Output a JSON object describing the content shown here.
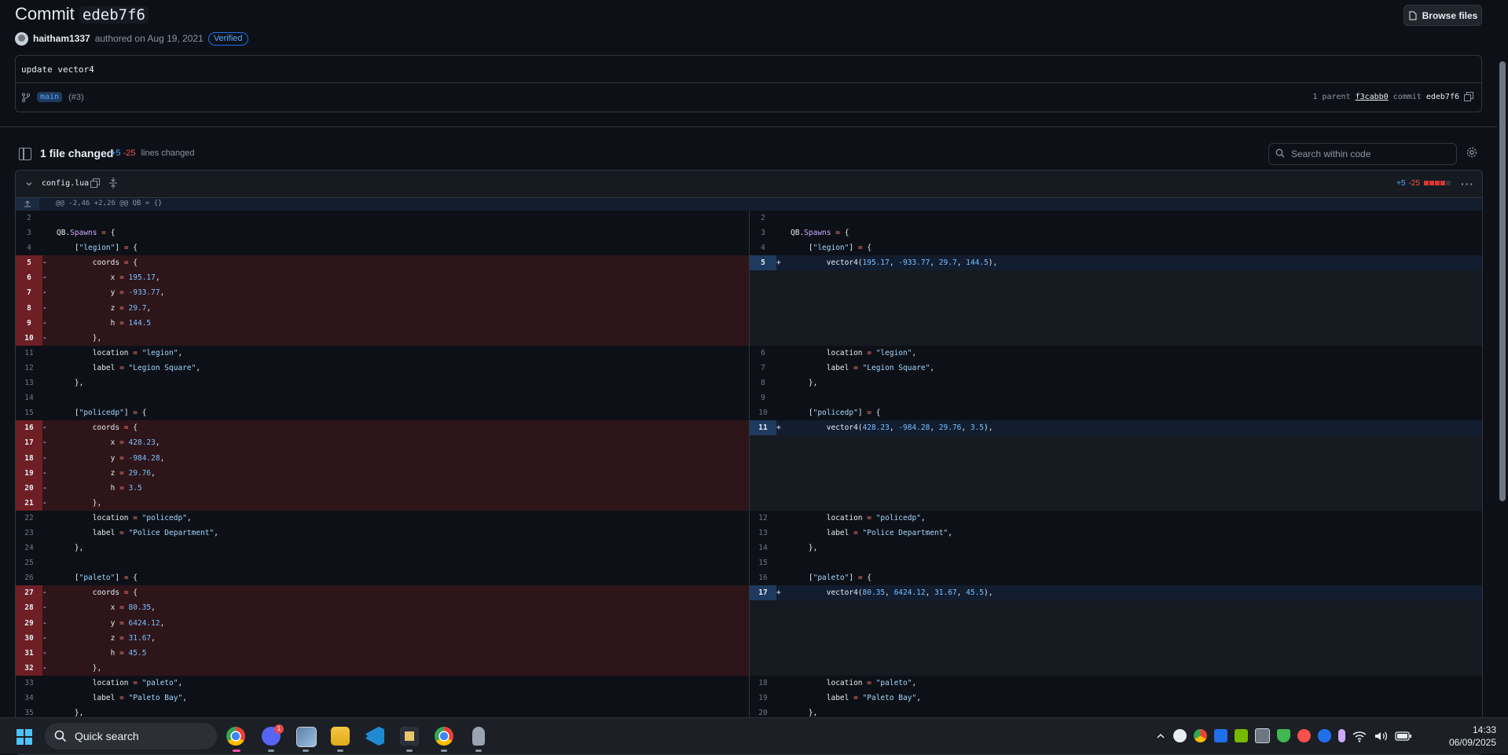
{
  "commit": {
    "title_prefix": "Commit",
    "sha_short": "edeb7f6",
    "browse_label": "Browse files",
    "author": "haitham1337",
    "authored_text": "authored on Aug 19, 2021",
    "verified_label": "Verified",
    "message": "update vector4",
    "branch": "main",
    "pr_ref": "(#3)",
    "parent_label": "1 parent",
    "parent_sha": "f3cabb0",
    "commit_label": "commit",
    "commit_sha": "edeb7f6"
  },
  "files_bar": {
    "files_changed": "1 file changed",
    "additions": "+5",
    "deletions": "-25",
    "lines_changed_label": "lines changed",
    "search_placeholder": "Search within code"
  },
  "file": {
    "name": "config.lua",
    "additions": "+5",
    "deletions": "-25",
    "hunk_header": "@@ -2,46 +2,26 @@ QB = {}"
  },
  "diff": {
    "left": [
      {
        "ln": "2",
        "sign": "",
        "type": "ctx",
        "code": ""
      },
      {
        "ln": "3",
        "sign": "",
        "type": "ctx",
        "code": "QB.Spawns = {"
      },
      {
        "ln": "4",
        "sign": "",
        "type": "ctx",
        "code": "    [\"legion\"] = {"
      },
      {
        "ln": "5",
        "sign": "-",
        "type": "del",
        "code": "        coords = {"
      },
      {
        "ln": "6",
        "sign": "-",
        "type": "del",
        "code": "            x = 195.17,"
      },
      {
        "ln": "7",
        "sign": "-",
        "type": "del",
        "code": "            y = -933.77,"
      },
      {
        "ln": "8",
        "sign": "-",
        "type": "del",
        "code": "            z = 29.7,"
      },
      {
        "ln": "9",
        "sign": "-",
        "type": "del",
        "code": "            h = 144.5"
      },
      {
        "ln": "10",
        "sign": "-",
        "type": "del",
        "code": "        },"
      },
      {
        "ln": "11",
        "sign": "",
        "type": "ctx",
        "code": "        location = \"legion\","
      },
      {
        "ln": "12",
        "sign": "",
        "type": "ctx",
        "code": "        label = \"Legion Square\","
      },
      {
        "ln": "13",
        "sign": "",
        "type": "ctx",
        "code": "    },"
      },
      {
        "ln": "14",
        "sign": "",
        "type": "ctx",
        "code": ""
      },
      {
        "ln": "15",
        "sign": "",
        "type": "ctx",
        "code": "    [\"policedp\"] = {"
      },
      {
        "ln": "16",
        "sign": "-",
        "type": "del",
        "code": "        coords = {"
      },
      {
        "ln": "17",
        "sign": "-",
        "type": "del",
        "code": "            x = 428.23,"
      },
      {
        "ln": "18",
        "sign": "-",
        "type": "del",
        "code": "            y = -984.28,"
      },
      {
        "ln": "19",
        "sign": "-",
        "type": "del",
        "code": "            z = 29.76,"
      },
      {
        "ln": "20",
        "sign": "-",
        "type": "del",
        "code": "            h = 3.5"
      },
      {
        "ln": "21",
        "sign": "-",
        "type": "del",
        "code": "        },"
      },
      {
        "ln": "22",
        "sign": "",
        "type": "ctx",
        "code": "        location = \"policedp\","
      },
      {
        "ln": "23",
        "sign": "",
        "type": "ctx",
        "code": "        label = \"Police Department\","
      },
      {
        "ln": "24",
        "sign": "",
        "type": "ctx",
        "code": "    },"
      },
      {
        "ln": "25",
        "sign": "",
        "type": "ctx",
        "code": ""
      },
      {
        "ln": "26",
        "sign": "",
        "type": "ctx",
        "code": "    [\"paleto\"] = {"
      },
      {
        "ln": "27",
        "sign": "-",
        "type": "del",
        "code": "        coords = {"
      },
      {
        "ln": "28",
        "sign": "-",
        "type": "del",
        "code": "            x = 80.35,"
      },
      {
        "ln": "29",
        "sign": "-",
        "type": "del",
        "code": "            y = 6424.12,"
      },
      {
        "ln": "30",
        "sign": "-",
        "type": "del",
        "code": "            z = 31.67,"
      },
      {
        "ln": "31",
        "sign": "-",
        "type": "del",
        "code": "            h = 45.5"
      },
      {
        "ln": "32",
        "sign": "-",
        "type": "del",
        "code": "        },"
      },
      {
        "ln": "33",
        "sign": "",
        "type": "ctx",
        "code": "        location = \"paleto\","
      },
      {
        "ln": "34",
        "sign": "",
        "type": "ctx",
        "code": "        label = \"Paleto Bay\","
      },
      {
        "ln": "35",
        "sign": "",
        "type": "ctx",
        "code": "    },"
      }
    ],
    "right": [
      {
        "ln": "2",
        "sign": "",
        "type": "ctx",
        "code": ""
      },
      {
        "ln": "3",
        "sign": "",
        "type": "ctx",
        "code": "QB.Spawns = {"
      },
      {
        "ln": "4",
        "sign": "",
        "type": "ctx",
        "code": "    [\"legion\"] = {"
      },
      {
        "ln": "5",
        "sign": "+",
        "type": "add",
        "code": "        vector4(195.17, -933.77, 29.7, 144.5),"
      },
      {
        "ln": "",
        "sign": "",
        "type": "empty",
        "code": ""
      },
      {
        "ln": "",
        "sign": "",
        "type": "empty",
        "code": ""
      },
      {
        "ln": "",
        "sign": "",
        "type": "empty",
        "code": ""
      },
      {
        "ln": "",
        "sign": "",
        "type": "empty",
        "code": ""
      },
      {
        "ln": "",
        "sign": "",
        "type": "empty",
        "code": ""
      },
      {
        "ln": "6",
        "sign": "",
        "type": "ctx",
        "code": "        location = \"legion\","
      },
      {
        "ln": "7",
        "sign": "",
        "type": "ctx",
        "code": "        label = \"Legion Square\","
      },
      {
        "ln": "8",
        "sign": "",
        "type": "ctx",
        "code": "    },"
      },
      {
        "ln": "9",
        "sign": "",
        "type": "ctx",
        "code": ""
      },
      {
        "ln": "10",
        "sign": "",
        "type": "ctx",
        "code": "    [\"policedp\"] = {"
      },
      {
        "ln": "11",
        "sign": "+",
        "type": "add",
        "code": "        vector4(428.23, -984.28, 29.76, 3.5),"
      },
      {
        "ln": "",
        "sign": "",
        "type": "empty",
        "code": ""
      },
      {
        "ln": "",
        "sign": "",
        "type": "empty",
        "code": ""
      },
      {
        "ln": "",
        "sign": "",
        "type": "empty",
        "code": ""
      },
      {
        "ln": "",
        "sign": "",
        "type": "empty",
        "code": ""
      },
      {
        "ln": "",
        "sign": "",
        "type": "empty",
        "code": ""
      },
      {
        "ln": "12",
        "sign": "",
        "type": "ctx",
        "code": "        location = \"policedp\","
      },
      {
        "ln": "13",
        "sign": "",
        "type": "ctx",
        "code": "        label = \"Police Department\","
      },
      {
        "ln": "14",
        "sign": "",
        "type": "ctx",
        "code": "    },"
      },
      {
        "ln": "15",
        "sign": "",
        "type": "ctx",
        "code": ""
      },
      {
        "ln": "16",
        "sign": "",
        "type": "ctx",
        "code": "    [\"paleto\"] = {"
      },
      {
        "ln": "17",
        "sign": "+",
        "type": "add",
        "code": "        vector4(80.35, 6424.12, 31.67, 45.5),"
      },
      {
        "ln": "",
        "sign": "",
        "type": "empty",
        "code": ""
      },
      {
        "ln": "",
        "sign": "",
        "type": "empty",
        "code": ""
      },
      {
        "ln": "",
        "sign": "",
        "type": "empty",
        "code": ""
      },
      {
        "ln": "",
        "sign": "",
        "type": "empty",
        "code": ""
      },
      {
        "ln": "",
        "sign": "",
        "type": "empty",
        "code": ""
      },
      {
        "ln": "18",
        "sign": "",
        "type": "ctx",
        "code": "        location = \"paleto\","
      },
      {
        "ln": "19",
        "sign": "",
        "type": "ctx",
        "code": "        label = \"Paleto Bay\","
      },
      {
        "ln": "20",
        "sign": "",
        "type": "ctx",
        "code": "    },"
      }
    ]
  },
  "taskbar": {
    "search_label": "Quick search",
    "discord_badge": "1",
    "time": "14:33",
    "date": "06/09/2025",
    "apps": [
      "chrome-icon",
      "discord-icon",
      "photos-icon",
      "file-explorer-icon",
      "vscode-icon",
      "davinci-resolve-icon",
      "chrome-profile-icon",
      "microphone-app-icon"
    ]
  },
  "colors": {
    "background": "#0d1117",
    "deletion": "#f85149",
    "addition": "#58a6ff",
    "link": "#58a6ff"
  }
}
